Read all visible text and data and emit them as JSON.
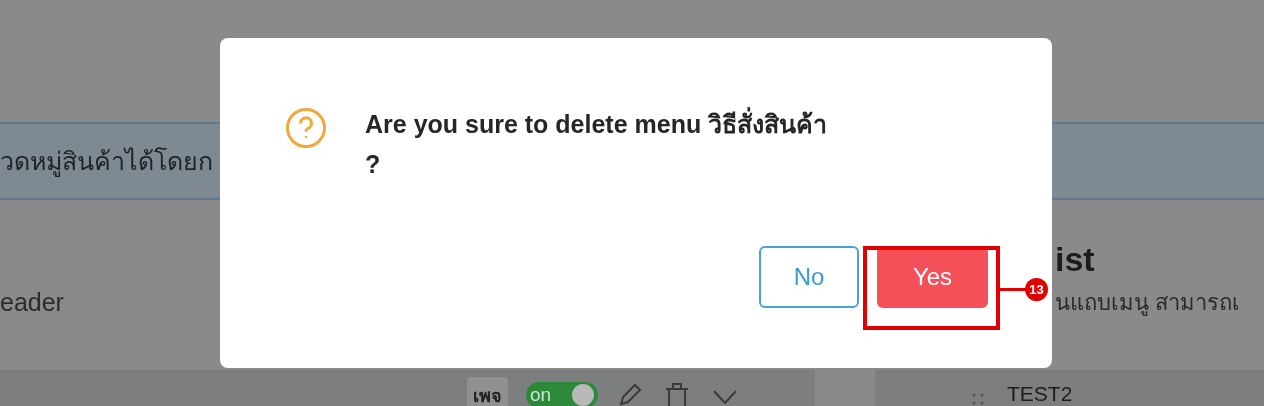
{
  "background": {
    "banner_text": "วดหมู่สินค้าได้โดยก",
    "left_label": "eader",
    "list_title": "ist",
    "list_subtitle": "นแถบเมนู สามารถเ",
    "row": {
      "page_tag": "เพจ",
      "toggle": {
        "label": "on",
        "on": true
      }
    },
    "list_items": [
      {
        "label": "TEST2"
      }
    ]
  },
  "dialog": {
    "message_lines": [
      "Are you sure to delete menu วิธีสั่งสินค้า",
      "?"
    ],
    "buttons": [
      {
        "label": "No",
        "kind": "secondary"
      },
      {
        "label": "Yes",
        "kind": "primary"
      }
    ]
  },
  "annotation": {
    "label": "13"
  }
}
